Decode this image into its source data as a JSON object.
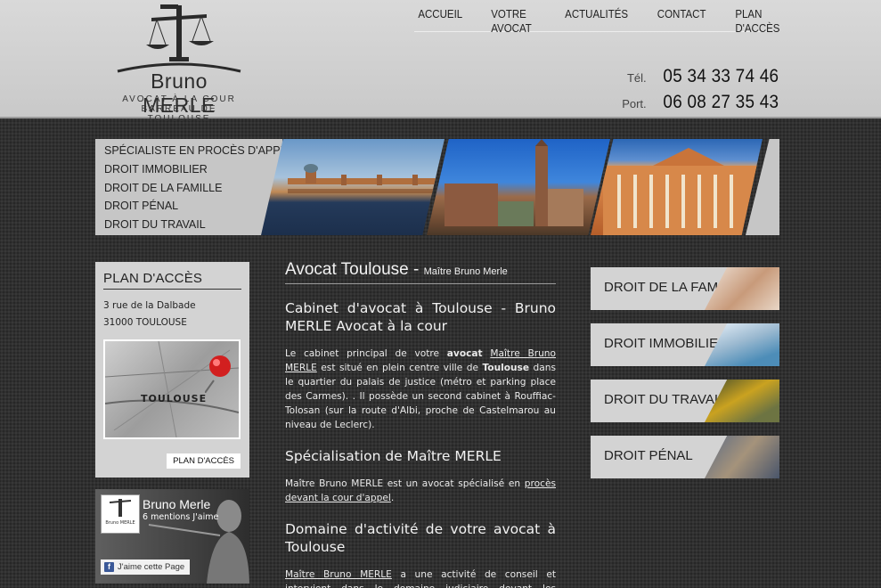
{
  "header": {
    "logo_name_first": "Bruno",
    "logo_name_last": "MERLE",
    "logo_line1": "AVOCAT À LA COUR",
    "logo_line2": "BARREAU DE TOULOUSE",
    "nav": [
      "ACCUEIL",
      "VOTRE AVOCAT",
      "ACTUALITÉS",
      "CONTACT",
      "PLAN D'ACCÈS"
    ],
    "tel_label": "Tél.",
    "tel_number": "05 34 33 74 46",
    "port_label": "Port.",
    "port_number": "06 08 27 35 43"
  },
  "banner": {
    "menu": [
      "SPÉCIALISTE EN PROCÈS D'APPEL",
      "DROIT IMMOBILIER",
      "DROIT DE LA FAMILLE",
      "DROIT PÉNAL",
      "DROIT DU TRAVAIL"
    ]
  },
  "access": {
    "title": "PLAN D'ACCÈS",
    "street": "3 rue de la Dalbade",
    "city": "31000 TOULOUSE",
    "map_label": "TOULOUSE",
    "button": "PLAN D'ACCÈS"
  },
  "facebook": {
    "page_name": "Bruno Merle",
    "likes": "6 mentions J'aime",
    "like_button": "J'aime cette Page",
    "thumb_text": "Bruno MERLE"
  },
  "content": {
    "title": "Avocat Toulouse",
    "title_sep": " - ",
    "title_small": "Maître Bruno Merle",
    "h2_1": "Cabinet d'avocat à Toulouse - Bruno MERLE Avocat à la cour",
    "p1_a": "Le cabinet principal de votre ",
    "p1_b": "avocat",
    "p1_c": " ",
    "p1_link": "Maître Bruno MERLE",
    "p1_d": " est situé en plein centre ville de ",
    "p1_e": "Toulouse",
    "p1_f": " dans le quartier du palais de justice (métro et parking place des Carmes). . Il possède un second cabinet à Rouffiac-Tolosan (sur la route d'Albi, proche de Castelmarou au niveau de Leclerc).",
    "h2_2": "Spécialisation de Maître MERLE",
    "p2_a": "Maître Bruno MERLE est un avocat spécialisé en ",
    "p2_link": "procès devant la cour d'appel",
    "p2_b": ".",
    "h2_3": "Domaine d'activité de votre avocat à Toulouse",
    "p3_link": "Maître Bruno MERLE",
    "p3_a": " a une activité de conseil et intervient dans le domaine judiciaire devant les juridictions civiles,"
  },
  "side_links": [
    "DROIT DE LA FAMILLE",
    "DROIT IMMOBILIER",
    "DROIT DU TRAVAIL",
    "DROIT PÉNAL"
  ],
  "colors": {
    "background": "#303030",
    "header": "#d0d0d0",
    "panel": "#d3d3d3",
    "facebook": "#3b5998"
  },
  "icons": [
    "scales-of-justice-logo",
    "map-pin-icon",
    "facebook-icon"
  ]
}
